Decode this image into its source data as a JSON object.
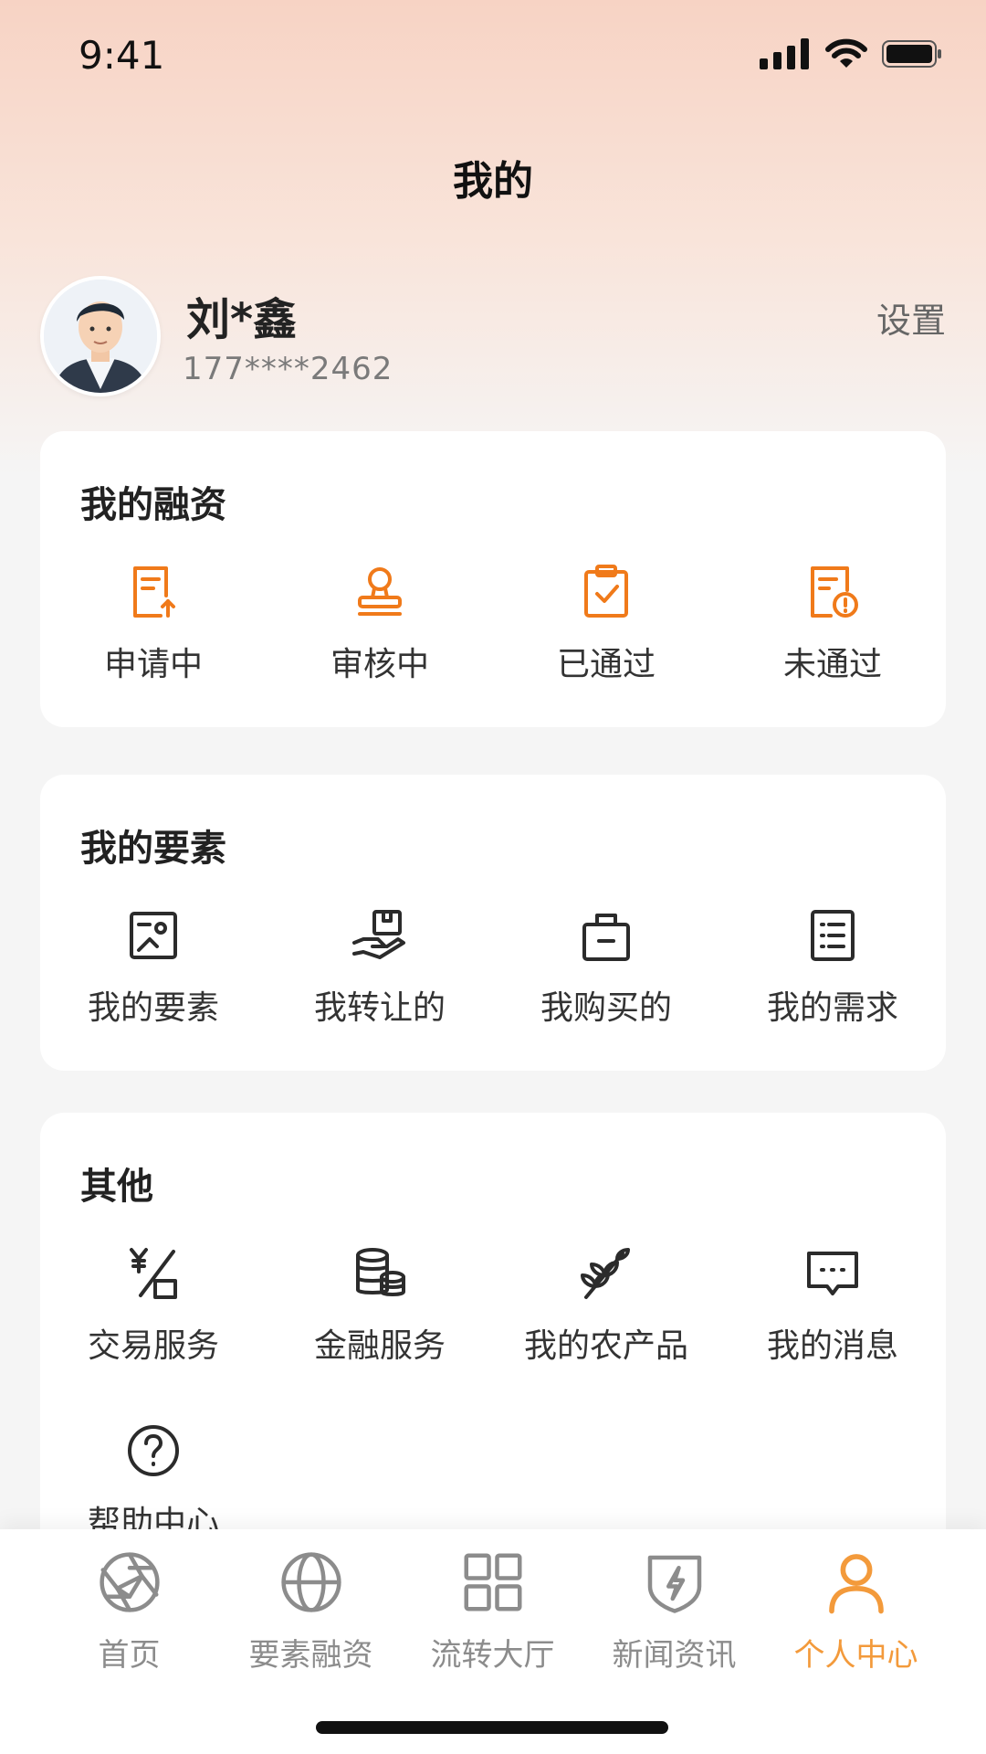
{
  "status_bar": {
    "time": "9:41"
  },
  "page": {
    "title": "我的"
  },
  "profile": {
    "name": "刘*鑫",
    "phone": "177****2462",
    "settings_label": "设置"
  },
  "colors": {
    "accent": "#F07A1A",
    "tab_active": "#F39A3B",
    "icon_dark": "#2b2b2b",
    "tab_inactive": "#8c8c8c"
  },
  "finance": {
    "title": "我的融资",
    "items": [
      {
        "label": "申请中",
        "icon": "document-upload-icon"
      },
      {
        "label": "审核中",
        "icon": "stamp-icon"
      },
      {
        "label": "已通过",
        "icon": "clipboard-check-icon"
      },
      {
        "label": "未通过",
        "icon": "document-alert-icon"
      }
    ]
  },
  "elements": {
    "title": "我的要素",
    "items": [
      {
        "label": "我的要素",
        "icon": "id-card-icon"
      },
      {
        "label": "我转让的",
        "icon": "hand-box-icon"
      },
      {
        "label": "我购买的",
        "icon": "shopping-bag-icon"
      },
      {
        "label": "我的需求",
        "icon": "list-document-icon"
      }
    ]
  },
  "others": {
    "title": "其他",
    "items": [
      {
        "label": "交易服务",
        "icon": "yuan-exchange-icon"
      },
      {
        "label": "金融服务",
        "icon": "coins-icon"
      },
      {
        "label": "我的农产品",
        "icon": "wheat-icon"
      },
      {
        "label": "我的消息",
        "icon": "message-icon"
      },
      {
        "label": "帮助中心",
        "icon": "help-icon"
      }
    ]
  },
  "tabbar": {
    "items": [
      {
        "label": "首页",
        "icon": "aperture-icon"
      },
      {
        "label": "要素融资",
        "icon": "globe-icon"
      },
      {
        "label": "流转大厅",
        "icon": "grid-icon"
      },
      {
        "label": "新闻资讯",
        "icon": "shield-bolt-icon"
      },
      {
        "label": "个人中心",
        "icon": "user-icon",
        "active": true
      }
    ]
  }
}
